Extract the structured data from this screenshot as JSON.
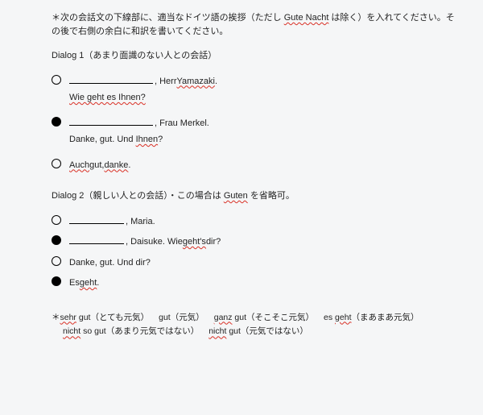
{
  "instruction_a": "＊次の会話文の下線部に、適当なドイツ語の挨拶（ただし ",
  "instruction_b": "Gute Nacht",
  "instruction_c": " は除く）を入れてください。その後で右側の余白に和訳を書いてください。",
  "d1": {
    "title_a": "Dialog 1（あまり面識のない人との会話）",
    "l1a": ", Herr ",
    "l1b": "Yamazaki",
    "l1c": ".",
    "l2": "Wie geht es Ihnen?",
    "l3a": ", Frau Merkel.",
    "l4a": "Danke, gut. Und ",
    "l4b": "Ihnen",
    "l4c": "?",
    "l5a": "Auch",
    "l5b": " gut, ",
    "l5c": "danke",
    "l5d": "."
  },
  "d2": {
    "title_a": "Dialog 2（親しい人との会話）・この場合は ",
    "title_b": "Guten",
    "title_c": " を省略可。",
    "l1": ", Maria.",
    "l2a": ", Daisuke. Wie ",
    "l2b": "geht's",
    "l2c": " dir?",
    "l3": "Danke, gut. Und dir?",
    "l4a": "Es ",
    "l4b": "geht",
    "l4c": "."
  },
  "foot": {
    "a1": "＊",
    "a2": "sehr",
    "a3": " gut（とても元気）",
    "b1": "gut（元気）",
    "c1": "ganz",
    "c2": " gut（そこそこ元気）",
    "d1": "es ",
    "d2": "geht",
    "d3": "（まあまあ元気）",
    "e1": "nicht",
    "e2": " so gut（あまり元気ではない）",
    "f1": "nicht",
    "f2": " gut（元気ではない）"
  }
}
